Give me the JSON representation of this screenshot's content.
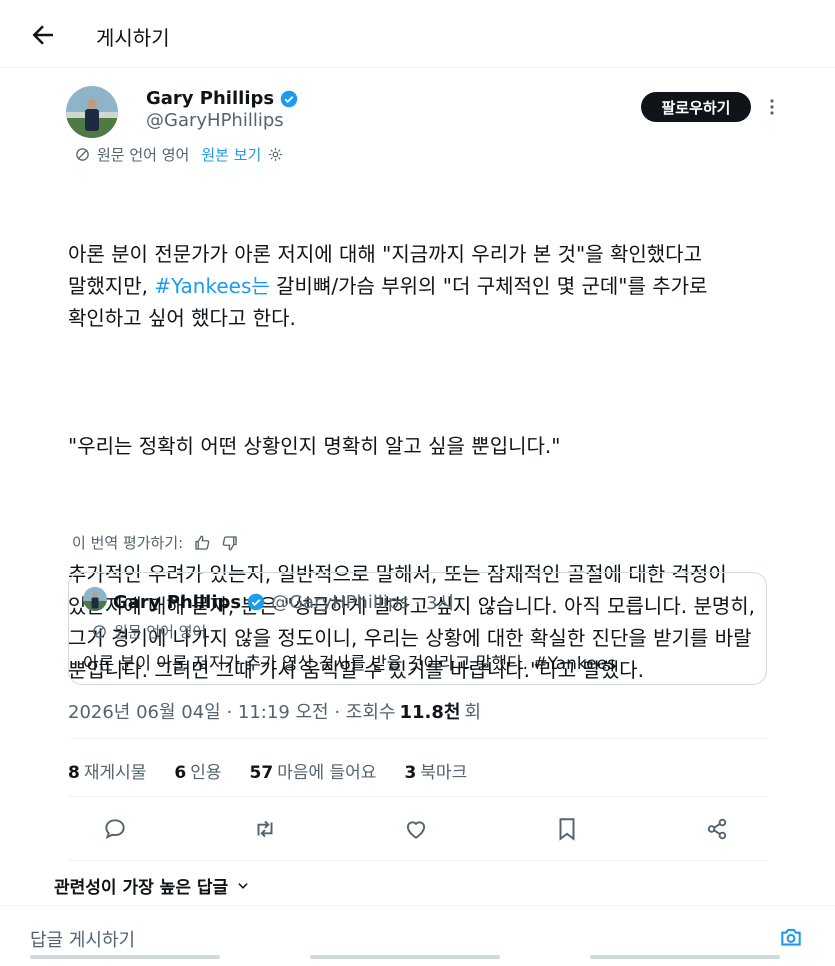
{
  "header": {
    "title": "게시하기"
  },
  "author": {
    "name": "Gary Phillips",
    "handle": "@GaryHPhillips",
    "follow_label": "팔로우하기"
  },
  "translation": {
    "source_label": "원문 언어 영어",
    "show_original": "원본 보기"
  },
  "tweet": {
    "para1_pre": "아론 분이 전문가가 아론 저지에 대해 \"지금까지 우리가 본 것\"을 확인했다고 말했지만, ",
    "hashtag": "#Yankees는",
    "para1_post": " 갈비뼈/가슴 부위의 \"더 구체적인 몇 군데\"를 추가로 확인하고 싶어 했다고 한다.",
    "para2": "\"우리는 정확히 어떤 상황인지 명확히 알고 싶을 뿐입니다.\"",
    "para3": "추가적인 우려가 있는지, 일반적으로 말해서, 또는 잠재적인 골절에 대한 걱정이 있는지에 대해 묻자, 분은 \"성급하게 말하고 싶지 않습니다. 아직 모릅니다. 분명히, 그가 경기에 나가지 않을 정도이니, 우리는 상황에 대한 확실한 진단을 받기를 바랄 뿐입니다. 그러면 그때 가서 움직일 수 있기를 바랍니다.\"라고 말했다."
  },
  "rate": {
    "label": "이 번역 평가하기:"
  },
  "quote": {
    "name": "Gary Phillips",
    "handle": "@GaryHPhillips",
    "time": "· 3시",
    "source_label": "원문 언어 영어",
    "text": "아론 분이 아론 저지가 추가 영상 검사를 받을 것이라고 말했다. #Yankees"
  },
  "meta": {
    "datetime": "2026년 06월 04일 · 11:19 오전 · 조회수",
    "views": "11.8천",
    "views_suffix": "회"
  },
  "stats": {
    "reposts_count": "8",
    "reposts_label": "재게시물",
    "quotes_count": "6",
    "quotes_label": "인용",
    "likes_count": "57",
    "likes_label": "마음에 들어요",
    "bookmarks_count": "3",
    "bookmarks_label": "북마크"
  },
  "sort": {
    "label": "관련성이 가장 높은 답글"
  },
  "reply": {
    "placeholder": "답글 게시하기"
  },
  "colors": {
    "accent": "#1d9bf0",
    "text": "#0f1419",
    "muted": "#536471",
    "border": "#cfd9de"
  }
}
